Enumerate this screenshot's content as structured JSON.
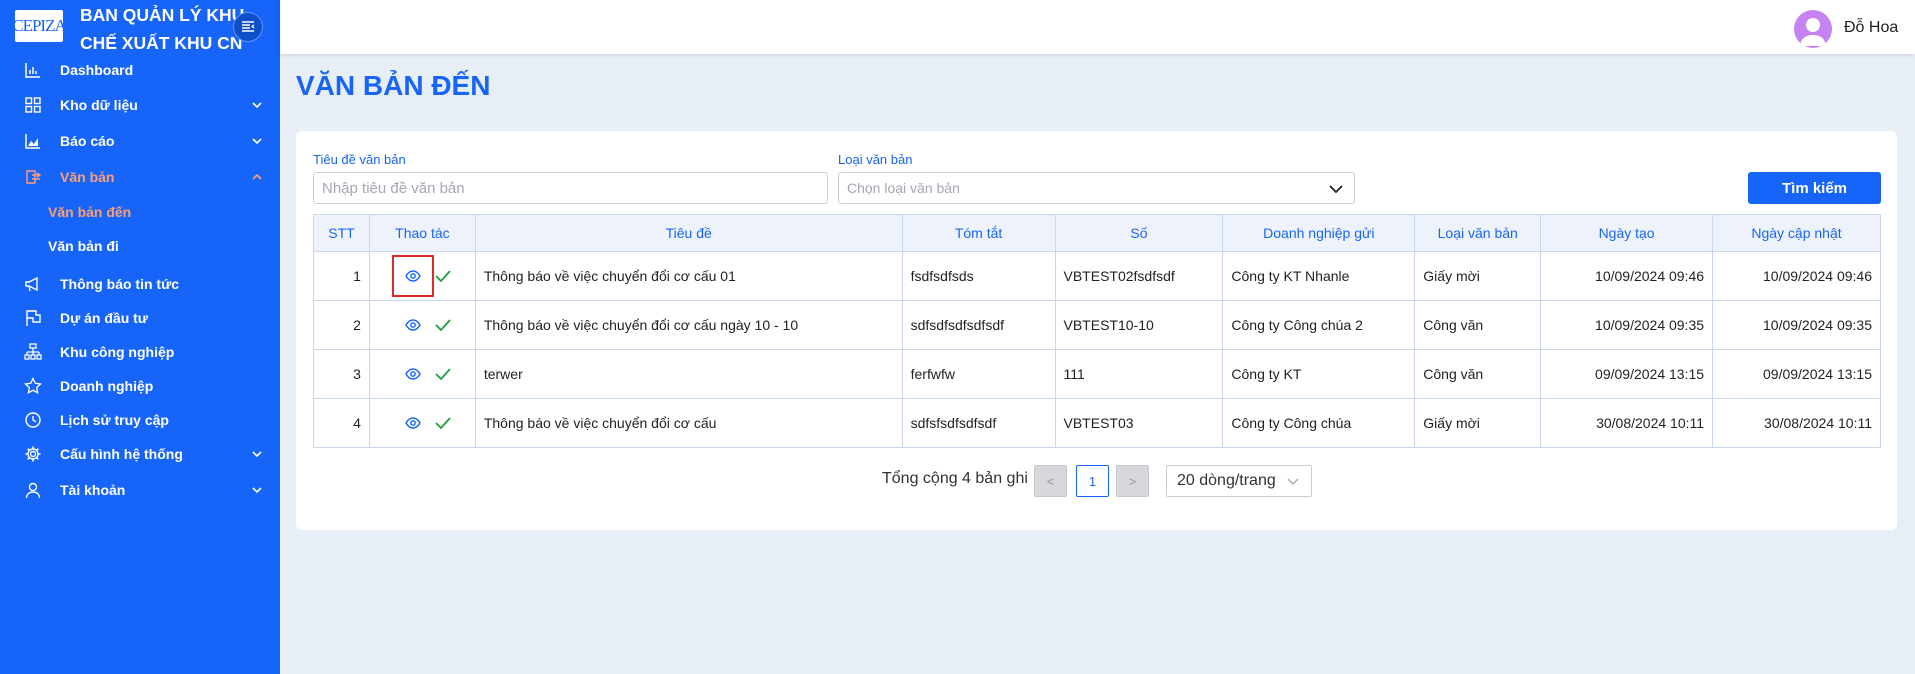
{
  "brand": {
    "logo_text": "CEPIZA",
    "title_line1": "BAN QUẢN LÝ KHU",
    "title_line2": "CHẾ XUẤT KHU CN"
  },
  "sidebar": {
    "items": [
      {
        "label": "Dashboard",
        "icon": "bar-chart-icon"
      },
      {
        "label": "Kho dữ liệu",
        "icon": "grid-icon",
        "expandable": true
      },
      {
        "label": "Báo cáo",
        "icon": "area-chart-icon",
        "expandable": true
      },
      {
        "label": "Văn bản",
        "icon": "document-swap-icon",
        "expandable": true,
        "expanded": true,
        "active": true
      },
      {
        "label": "Thông báo tin tức",
        "icon": "megaphone-icon"
      },
      {
        "label": "Dự án đầu tư",
        "icon": "flag-icon"
      },
      {
        "label": "Khu công nghiệp",
        "icon": "org-chart-icon"
      },
      {
        "label": "Doanh nghiệp",
        "icon": "star-icon"
      },
      {
        "label": "Lịch sử truy cập",
        "icon": "clock-icon"
      },
      {
        "label": "Cấu hình hệ thống",
        "icon": "gear-icon",
        "expandable": true
      },
      {
        "label": "Tài khoản",
        "icon": "user-icon",
        "expandable": true
      }
    ],
    "sub_items": [
      {
        "label": "Văn bản đến",
        "active": true
      },
      {
        "label": "Văn bản đi"
      }
    ]
  },
  "header": {
    "username": "Đỗ Hoa"
  },
  "page": {
    "title": "VĂN BẢN ĐẾN"
  },
  "filters": {
    "title_label": "Tiêu đề văn bản",
    "title_placeholder": "Nhập tiêu đề văn bản",
    "type_label": "Loại văn bản",
    "type_placeholder": "Chọn loại văn bản",
    "search_button": "Tìm kiếm"
  },
  "table": {
    "columns": [
      "STT",
      "Thao tác",
      "Tiêu đề",
      "Tóm tắt",
      "Số",
      "Doanh nghiệp gửi",
      "Loại văn bản",
      "Ngày tạo",
      "Ngày cập nhật"
    ],
    "rows": [
      {
        "stt": "1",
        "title": "Thông báo về việc chuyển đổi cơ cấu 01",
        "summary": "fsdfsdfsds",
        "number": "VBTEST02fsdfsdf",
        "company": "Công ty KT Nhanle",
        "type": "Giấy mời",
        "created": "10/09/2024 09:46",
        "updated": "10/09/2024 09:46"
      },
      {
        "stt": "2",
        "title": "Thông báo về việc chuyển đổi cơ cấu ngày 10 - 10",
        "summary": "sdfsdfsdfsdfsdf",
        "number": "VBTEST10-10",
        "company": "Công ty Công chúa 2",
        "type": "Công văn",
        "created": "10/09/2024 09:35",
        "updated": "10/09/2024 09:35"
      },
      {
        "stt": "3",
        "title": "terwer",
        "summary": "ferfwfw",
        "number": "111",
        "company": "Công ty KT",
        "type": "Công văn",
        "created": "09/09/2024 13:15",
        "updated": "09/09/2024 13:15"
      },
      {
        "stt": "4",
        "title": "Thông báo về việc chuyển đổi cơ cấu",
        "summary": "sdfsfsdfsdfsdf",
        "number": "VBTEST03",
        "company": "Công ty Công chúa",
        "type": "Giấy mời",
        "created": "30/08/2024 10:11",
        "updated": "30/08/2024 10:11"
      }
    ]
  },
  "pagination": {
    "total_text": "Tổng cộng 4 bản ghi",
    "prev": "<",
    "current_page": "1",
    "next": ">",
    "page_size": "20 dòng/trang"
  },
  "colors": {
    "primary": "#1765f8",
    "active_menu": "#ff9d73",
    "approve_check": "#1e9e3a",
    "focus_box": "#e12a2a"
  }
}
